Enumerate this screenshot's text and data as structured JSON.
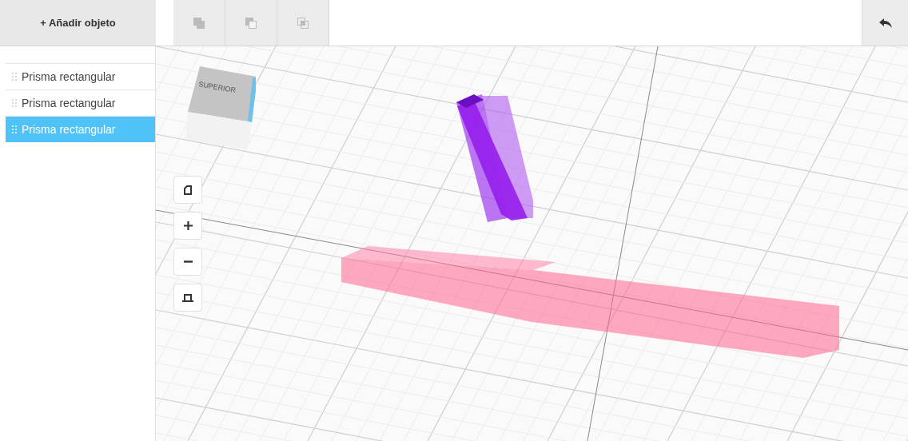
{
  "add_button": {
    "label": "+ Añadir objeto"
  },
  "objects": [
    {
      "label": "Prisma rectangular",
      "selected": false
    },
    {
      "label": "Prisma rectangular",
      "selected": false
    },
    {
      "label": "Prisma rectangular",
      "selected": true
    }
  ],
  "view_cube": {
    "top_label": "SUPERIOR"
  }
}
